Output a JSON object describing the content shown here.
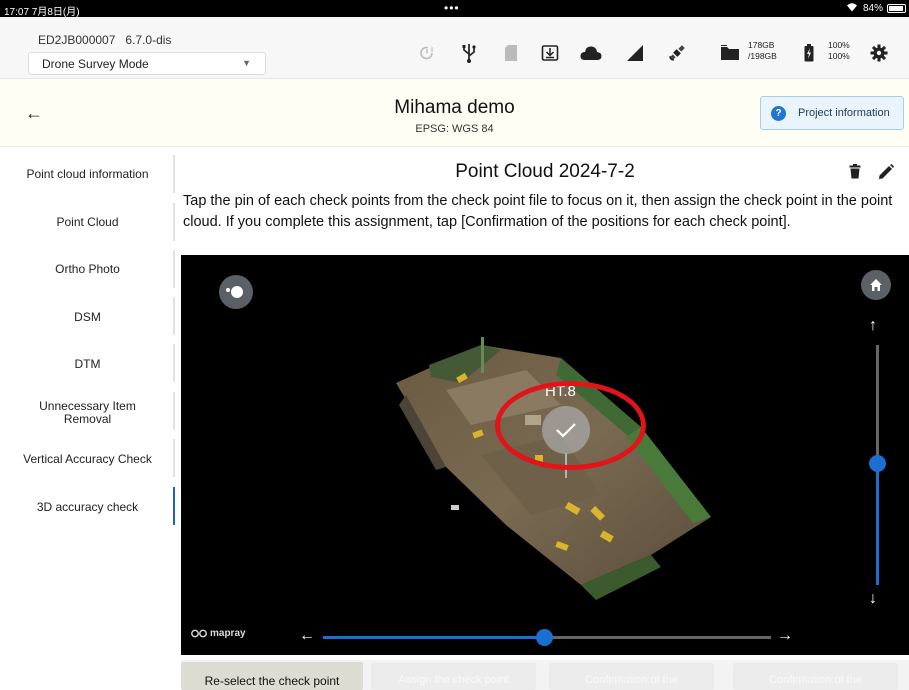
{
  "status_bar": {
    "time": "17:07 7月8日(月)",
    "dots": "•••",
    "battery_percent": "84%"
  },
  "device": {
    "id": "ED2JB000007",
    "version": "6.7.0-dis",
    "mode": "Drone Survey Mode"
  },
  "toolbar": {
    "icons": [
      "camera-timer-icon",
      "usb-icon",
      "sd-card-icon",
      "download-icon",
      "cloud-icon",
      "signal-icon",
      "satellite-icon",
      "folder-icon",
      "battery-icon",
      "settings-icon"
    ],
    "storage_used": "178GB",
    "storage_total": "/198GB",
    "battery_1": "100%",
    "battery_2": "100%"
  },
  "header": {
    "project_title": "Mihama demo",
    "subtitle": "EPSG: WGS 84",
    "project_info_button": "Project information"
  },
  "sidebar": {
    "items": [
      {
        "label": "Point cloud information",
        "active": false
      },
      {
        "label": "Point Cloud",
        "active": false
      },
      {
        "label": "Ortho Photo",
        "active": false
      },
      {
        "label": "DSM",
        "active": false
      },
      {
        "label": "DTM",
        "active": false
      },
      {
        "label": "Unnecessary Item\nRemoval",
        "active": false
      },
      {
        "label": "Vertical Accuracy Check",
        "active": false
      },
      {
        "label": "3D accuracy check",
        "active": true
      }
    ]
  },
  "main": {
    "title": "Point Cloud 2024-7-2",
    "instructions": "Tap the pin of each check points from the check point file to focus on it, then assign the check point in the point cloud. If you complete this assignment, tap [Confirmation of the positions for each check point].",
    "viewer": {
      "pin_label": "HT.8",
      "brand": "mapray",
      "vertical_slider_level": 0.5,
      "horizontal_slider_level": 0.5
    }
  },
  "bottom": {
    "reselect_label": "Re-select the check point",
    "disabled_buttons": [
      "Assign the check point",
      "Confirmation of the",
      "Confirmation of the"
    ]
  },
  "colors": {
    "accent": "#1a6fd1",
    "highlight_ring": "#e3131a",
    "sidebar_active": "#1f63b5"
  }
}
